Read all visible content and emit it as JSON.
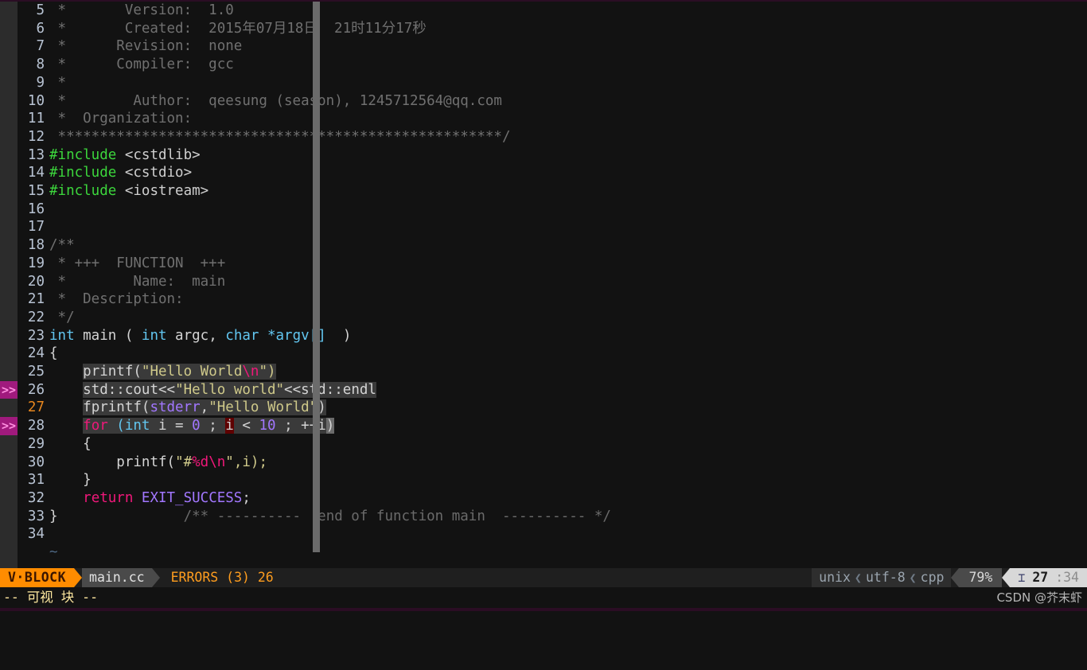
{
  "app": {
    "name": "vim",
    "filetype": "cpp",
    "background": "#121212"
  },
  "colors": {
    "mode_badge_bg": "#ff8c00",
    "mode_badge_fg": "#3a1500",
    "file_seg_bg": "#4a4a4a",
    "errors_fg": "#ff9d1e",
    "sign_error_bg": "#a01a7d",
    "selection_bg": "#3a3a3a",
    "cursor_char_bg": "#5f0000",
    "cursor_line_number_fg": "#e8871e",
    "line_number_fg": "#b9c4d4",
    "comment_fg": "#707070",
    "preproc_fg": "#3cd63c",
    "type_fg": "#62c6f0",
    "string_fg": "#cfc98a",
    "keyword_fg": "#f0187a",
    "constant_fg": "#a277ff"
  },
  "editor": {
    "tilde_char": "~",
    "sign_marker": ">>",
    "lines": [
      {
        "num": "5",
        "sign": "",
        "cursor": false
      },
      {
        "num": "6",
        "sign": "",
        "cursor": false
      },
      {
        "num": "7",
        "sign": "",
        "cursor": false
      },
      {
        "num": "8",
        "sign": "",
        "cursor": false
      },
      {
        "num": "9",
        "sign": "",
        "cursor": false
      },
      {
        "num": "10",
        "sign": "",
        "cursor": false
      },
      {
        "num": "11",
        "sign": "",
        "cursor": false
      },
      {
        "num": "12",
        "sign": "",
        "cursor": false
      },
      {
        "num": "13",
        "sign": "",
        "cursor": false
      },
      {
        "num": "14",
        "sign": "",
        "cursor": false
      },
      {
        "num": "15",
        "sign": "",
        "cursor": false
      },
      {
        "num": "16",
        "sign": "",
        "cursor": false
      },
      {
        "num": "17",
        "sign": "",
        "cursor": false
      },
      {
        "num": "18",
        "sign": "",
        "cursor": false
      },
      {
        "num": "19",
        "sign": "",
        "cursor": false
      },
      {
        "num": "20",
        "sign": "",
        "cursor": false
      },
      {
        "num": "21",
        "sign": "",
        "cursor": false
      },
      {
        "num": "22",
        "sign": "",
        "cursor": false
      },
      {
        "num": "23",
        "sign": "",
        "cursor": false
      },
      {
        "num": "24",
        "sign": "",
        "cursor": false
      },
      {
        "num": "25",
        "sign": "",
        "cursor": false
      },
      {
        "num": "26",
        "sign": ">>",
        "cursor": false
      },
      {
        "num": "27",
        "sign": "",
        "cursor": true
      },
      {
        "num": "28",
        "sign": ">>",
        "cursor": false
      },
      {
        "num": "29",
        "sign": "",
        "cursor": false
      },
      {
        "num": "30",
        "sign": "",
        "cursor": false
      },
      {
        "num": "31",
        "sign": "",
        "cursor": false
      },
      {
        "num": "32",
        "sign": "",
        "cursor": false
      },
      {
        "num": "33",
        "sign": "",
        "cursor": false
      },
      {
        "num": "34",
        "sign": "",
        "cursor": false
      }
    ],
    "source_text": {
      "l5": " *       Version:  1.0",
      "l6": " *       Created:  2015年07月18日  21时11分17秒",
      "l7": " *      Revision:  none",
      "l8": " *      Compiler:  gcc",
      "l9": " *",
      "l10": " *        Author:  qeesung (season), 1245712564@qq.com",
      "l11": " *  Organization:",
      "l12": " *****************************************************/",
      "l13": "#include <cstdlib>",
      "l14": "#include <cstdio>",
      "l15": "#include <iostream>",
      "l16": "",
      "l17": "",
      "l18": "/**",
      "l19": " * +++  FUNCTION  +++",
      "l20": " *        Name:  main",
      "l21": " *  Description:",
      "l22": " */",
      "l23": "int main ( int argc, char *argv[] )",
      "l24": "{",
      "l25": "    printf(\"Hello World\\n\")",
      "l26": "    std::cout<<\"Hello world\"<<std::endl",
      "l27": "    fprintf(stderr,\"Hello World\")",
      "l28": "    for (int i = 0 ; i < 10 ; ++i)",
      "l29": "    {",
      "l30": "        printf(\"#%d\\n\",i);",
      "l31": "    }",
      "l32": "    return EXIT_SUCCESS;",
      "l33": "}               /** ----------  end of function main  ---------- */",
      "l34": ""
    },
    "tokens": {
      "version_label": " *       Version:  1.0",
      "created_label": " *       Created:  2015年07月18日  21时11分17秒",
      "revision_label": " *      Revision:  none",
      "compiler_label": " *      Compiler:  gcc",
      "star_only": " *",
      "author_label": " *        Author:  qeesung (season), 1245712564@qq.com",
      "organization_label": " *  Organization:",
      "comment_close_bar": " *****************************************************/",
      "include_kw": "#include",
      "inc_cstdlib": " <cstdlib>",
      "inc_cstdio": " <cstdio>",
      "inc_iostream": " <iostream>",
      "doc_open": "/**",
      "doc_function": " * +++  FUNCTION  +++",
      "doc_name": " *        Name:  main",
      "doc_description": " *  Description:",
      "doc_close": " */",
      "kw_int": "int",
      "fn_main": " main ( ",
      "kw_int2": "int",
      "argc": " argc, ",
      "kw_char": "char",
      "argv": " *argv[]",
      "paren_close": ")",
      "brace_open": "{",
      "printf_call": "printf(",
      "str_hello_world": "\"Hello World",
      "esc_n": "\\n",
      "str_close_paren": "\")",
      "std_cout": "std::cout<<",
      "str_hello_world_lower": "\"Hello world\"",
      "std_endl": "<<std::endl",
      "fprintf_call": "fprintf(",
      "stderr_const": "stderr",
      "comma": ",",
      "str_hello_world2": "\"Hello World\"",
      "close_paren": ")",
      "kw_for": "for",
      "for_open": " (",
      "for_int": "int",
      "for_i_eq": " i = ",
      "num_zero": "0",
      "semi_sp": " ; ",
      "var_i": "i",
      "lt_sp": " < ",
      "num_ten": "10",
      "semi_sp2": " ; ++i",
      "for_close": ")",
      "brace_open_body": "{",
      "printf_inner": "printf(",
      "str_hash": "\"#",
      "fmt_d": "%d",
      "esc_n2": "\\n",
      "str_end_i": "\",i);",
      "brace_close": "}",
      "kw_return": "return",
      "exit_success": " EXIT_SUCCESS",
      "semicolon": ";",
      "brace_close_fn": "}",
      "end_comment": "               /** ----------  end of function main  ---------- */"
    }
  },
  "statusline": {
    "mode": "V·BLOCK",
    "filename": "main.cc",
    "errors": "ERRORS (3)  26",
    "fileformat": "unix",
    "encoding": "utf-8",
    "filetype": "cpp",
    "separator_chevron": "❮",
    "percent": "79%",
    "position_icon": "⌶",
    "line": "27",
    "column": ":34"
  },
  "messageline": {
    "text": "-- 可视 块 --",
    "watermark": "CSDN @芥末虾"
  }
}
